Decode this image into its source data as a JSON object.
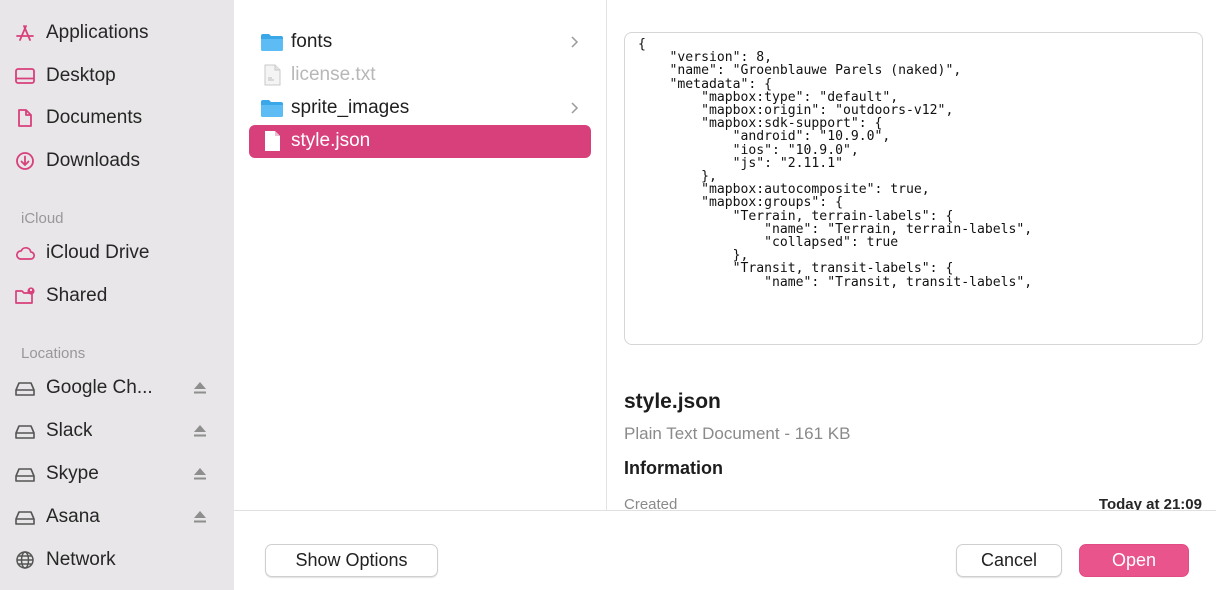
{
  "colors": {
    "accent": "#d8407c",
    "open_button": "#e9548c",
    "sidebar_bg": "#e8e6e8"
  },
  "sidebar": {
    "favorites": [
      {
        "label": "Applications",
        "icon": "applications-icon"
      },
      {
        "label": "Desktop",
        "icon": "desktop-icon"
      },
      {
        "label": "Documents",
        "icon": "documents-icon"
      },
      {
        "label": "Downloads",
        "icon": "downloads-icon"
      }
    ],
    "icloud_heading": "iCloud",
    "icloud": [
      {
        "label": "iCloud Drive",
        "icon": "cloud-icon"
      },
      {
        "label": "Shared",
        "icon": "shared-folder-icon"
      }
    ],
    "locations_heading": "Locations",
    "locations": [
      {
        "label": "Google Ch...",
        "icon": "drive-icon",
        "eject": true
      },
      {
        "label": "Slack",
        "icon": "drive-icon",
        "eject": true
      },
      {
        "label": "Skype",
        "icon": "drive-icon",
        "eject": true
      },
      {
        "label": "Asana",
        "icon": "drive-icon",
        "eject": true
      },
      {
        "label": "Network",
        "icon": "network-icon",
        "eject": false
      }
    ]
  },
  "files": [
    {
      "name": "fonts",
      "type": "folder",
      "state": "normal"
    },
    {
      "name": "license.txt",
      "type": "file",
      "state": "disabled"
    },
    {
      "name": "sprite_images",
      "type": "folder",
      "state": "normal"
    },
    {
      "name": "style.json",
      "type": "file",
      "state": "selected"
    }
  ],
  "preview": {
    "code": "{\n    \"version\": 8,\n    \"name\": \"Groenblauwe Parels (naked)\",\n    \"metadata\": {\n        \"mapbox:type\": \"default\",\n        \"mapbox:origin\": \"outdoors-v12\",\n        \"mapbox:sdk-support\": {\n            \"android\": \"10.9.0\",\n            \"ios\": \"10.9.0\",\n            \"js\": \"2.11.1\"\n        },\n        \"mapbox:autocomposite\": true,\n        \"mapbox:groups\": {\n            \"Terrain, terrain-labels\": {\n                \"name\": \"Terrain, terrain-labels\",\n                \"collapsed\": true\n            },\n            \"Transit, transit-labels\": {\n                \"name\": \"Transit, transit-labels\",",
    "title": "style.json",
    "kind": "Plain Text Document - 161 KB",
    "info_heading": "Information",
    "created_label": "Created",
    "created_value": "Today at 21:09"
  },
  "buttons": {
    "show_options": "Show Options",
    "cancel": "Cancel",
    "open": "Open"
  }
}
